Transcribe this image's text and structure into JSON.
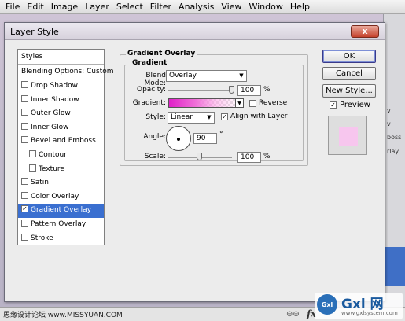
{
  "menubar": {
    "items": [
      "File",
      "Edit",
      "Image",
      "Layer",
      "Select",
      "Filter",
      "Analysis",
      "View",
      "Window",
      "Help"
    ]
  },
  "dialog": {
    "title": "Layer Style",
    "close_label": "x",
    "styles_list": {
      "header": "Styles",
      "blending_options": "Blending Options: Custom",
      "items": [
        {
          "label": "Drop Shadow",
          "checked": false,
          "indent": false,
          "selected": false
        },
        {
          "label": "Inner Shadow",
          "checked": false,
          "indent": false,
          "selected": false
        },
        {
          "label": "Outer Glow",
          "checked": false,
          "indent": false,
          "selected": false
        },
        {
          "label": "Inner Glow",
          "checked": false,
          "indent": false,
          "selected": false
        },
        {
          "label": "Bevel and Emboss",
          "checked": false,
          "indent": false,
          "selected": false
        },
        {
          "label": "Contour",
          "checked": false,
          "indent": true,
          "selected": false
        },
        {
          "label": "Texture",
          "checked": false,
          "indent": true,
          "selected": false
        },
        {
          "label": "Satin",
          "checked": false,
          "indent": false,
          "selected": false
        },
        {
          "label": "Color Overlay",
          "checked": false,
          "indent": false,
          "selected": false
        },
        {
          "label": "Gradient Overlay",
          "checked": true,
          "indent": false,
          "selected": true
        },
        {
          "label": "Pattern Overlay",
          "checked": false,
          "indent": false,
          "selected": false
        },
        {
          "label": "Stroke",
          "checked": false,
          "indent": false,
          "selected": false
        }
      ]
    },
    "gradient_overlay": {
      "section_title": "Gradient Overlay",
      "group_title": "Gradient",
      "blend_mode_label": "Blend Mode:",
      "blend_mode_value": "Overlay",
      "opacity_label": "Opacity:",
      "opacity_value": "100",
      "opacity_level": 1.0,
      "percent": "%",
      "gradient_label": "Gradient:",
      "gradient_colors": [
        "#e020c8",
        "#ffc8f0"
      ],
      "reverse_label": "Reverse",
      "reverse_checked": false,
      "style_label": "Style:",
      "style_value": "Linear",
      "align_label": "Align with Layer",
      "align_checked": true,
      "angle_label": "Angle:",
      "angle_value": "90",
      "degree": "°",
      "scale_label": "Scale:",
      "scale_value": "100",
      "scale_level": 0.5
    },
    "buttons": {
      "ok": "OK",
      "cancel": "Cancel",
      "new_style": "New Style..."
    },
    "preview_label": "Preview",
    "preview_checked": true,
    "preview_color": "#f7c6ee"
  },
  "background": {
    "panel_snippets": [
      "...",
      "v",
      "v",
      "boss",
      "rlay"
    ],
    "bottom_text": "思缘设计论坛 www.MISSYUAN.COM",
    "fx_label": "fx"
  },
  "watermark": {
    "logo_text": "Gxl",
    "brand": "Gxl 网",
    "url": "www.gxlsystem.com"
  }
}
